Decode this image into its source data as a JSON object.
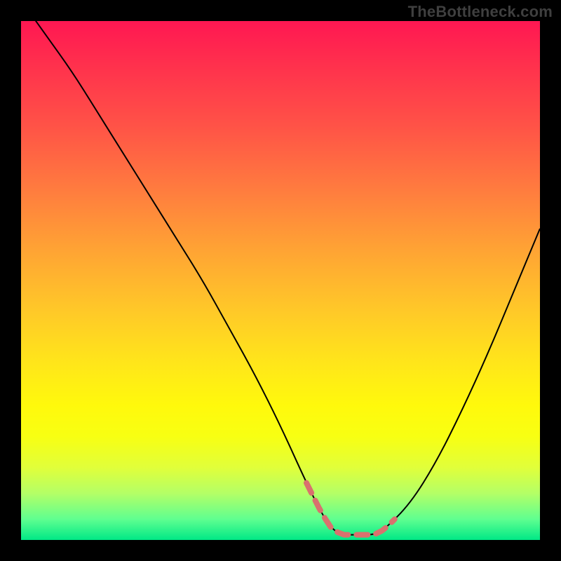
{
  "watermark": "TheBottleneck.com",
  "colors": {
    "background": "#000000",
    "curve_stroke": "#000000",
    "dash_stroke": "#d9716e",
    "gradient_top": "#ff1752",
    "gradient_bottom": "#00e886"
  },
  "chart_data": {
    "type": "line",
    "title": "",
    "xlabel": "",
    "ylabel": "",
    "xlim": [
      0,
      100
    ],
    "ylim": [
      0,
      100
    ],
    "grid": false,
    "legend": false,
    "series": [
      {
        "name": "bottleneck-curve",
        "x": [
          0,
          5,
          10,
          15,
          20,
          25,
          30,
          35,
          40,
          45,
          50,
          55,
          58,
          60,
          62,
          65,
          68,
          70,
          75,
          80,
          85,
          90,
          95,
          100
        ],
        "y": [
          104,
          97,
          90,
          82,
          74,
          66,
          58,
          50,
          41,
          32,
          22,
          11,
          5,
          2,
          1,
          1,
          1,
          2,
          7,
          15,
          25,
          36,
          48,
          60
        ]
      }
    ],
    "annotations": [
      {
        "name": "low-bottleneck-region",
        "type": "dash-highlight",
        "x_range": [
          55,
          72
        ],
        "description": "Pink dashed segment marking the valley (near-zero) portion of the curve"
      }
    ],
    "background": {
      "type": "vertical-gradient",
      "meaning": "red high → green low (bottleneck severity)",
      "stops": [
        {
          "pos": 0.0,
          "color": "#ff1752"
        },
        {
          "pos": 0.5,
          "color": "#ffc928"
        },
        {
          "pos": 0.8,
          "color": "#f8ff12"
        },
        {
          "pos": 1.0,
          "color": "#00e886"
        }
      ]
    }
  }
}
